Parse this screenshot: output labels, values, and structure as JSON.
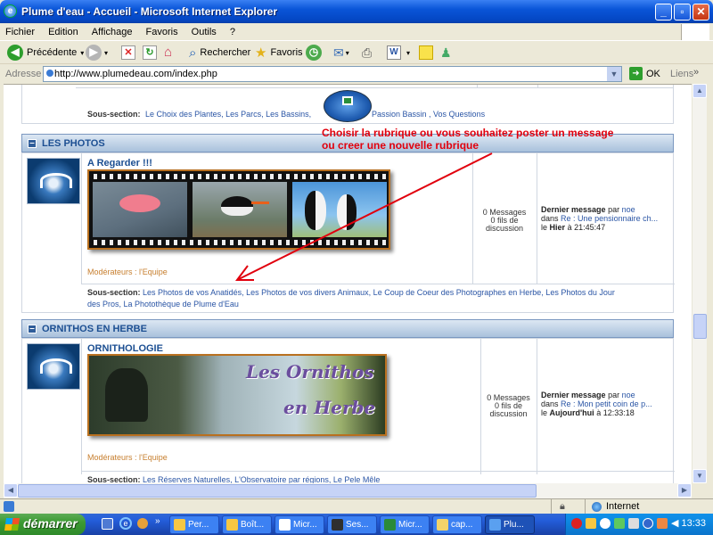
{
  "window": {
    "title": "Plume d'eau - Accueil - Microsoft Internet Explorer"
  },
  "menu": [
    "Fichier",
    "Edition",
    "Affichage",
    "Favoris",
    "Outils",
    "?"
  ],
  "toolbar": {
    "back": "Précédente",
    "search": "Rechercher",
    "favorites": "Favoris"
  },
  "address": {
    "label": "Adresse",
    "url": "http://www.plumedeau.com/index.php",
    "go": "OK",
    "links": "Liens"
  },
  "top_section": {
    "label": "Sous-section:",
    "links": "Le Choix des Plantes, Les Parcs, Les Bassins,",
    "links2": "Passion Bassin , Vos Questions"
  },
  "annotation": {
    "line1": "Choisir la rubrique ou vous souhaitez poster un message",
    "line2": "ou creer une nouvelle rubrique",
    "color": "#e1000d"
  },
  "photos": {
    "header": "LES PHOTOS",
    "forum_title": "A Regarder !!!",
    "moderators": "Modérateurs : l'Equipe",
    "stats": {
      "messages": "0 Messages",
      "threads": "0 fils de",
      "threads2": "discussion"
    },
    "last": {
      "label": "Dernier message",
      "by": "par",
      "user": "noe",
      "in": "dans",
      "topic": "Re : Une pensionnaire ch...",
      "when_prefix": "le",
      "when_day": "Hier",
      "when_time": "à 21:45:47"
    },
    "subs_label": "Sous-section:",
    "subs_line1": "Les Photos de vos Anatidés, Les Photos de vos divers Animaux, Le Coup de Coeur des Photographes en Herbe, Les Photos du Jour",
    "subs_line2": "des Pros, La Photothèque de Plume d'Eau"
  },
  "ornithos": {
    "header": "ORNITHOS EN HERBE",
    "forum_title": "ORNITHOLOGIE",
    "banner_line1": "Les Ornithos",
    "banner_line2": "en Herbe",
    "moderators": "Modérateurs : l'Equipe",
    "stats": {
      "messages": "0 Messages",
      "threads": "0 fils de",
      "threads2": "discussion"
    },
    "last": {
      "label": "Dernier message",
      "by": "par",
      "user": "noe",
      "in": "dans",
      "topic": "Re : Mon petit coin de p...",
      "when_prefix": "le",
      "when_day": "Aujourd'hui",
      "when_time": "à 12:33:18"
    },
    "subs_label": "Sous-section:",
    "subs_line1": "Les Réserves Naturelles, L'Observatoire par régions, Le Pele Mêle"
  },
  "status": {
    "zone": "Internet"
  },
  "taskbar": {
    "start": "démarrer",
    "tasks": [
      "Per...",
      "Boît...",
      "Micr...",
      "Ses...",
      "Micr...",
      "cap...",
      "Plu..."
    ],
    "clock": "13:33"
  },
  "colors": {
    "accent": "#1c4f92",
    "annotation": "#e1000d",
    "moderator": "#c77f2f",
    "taskbar": "#245edb"
  }
}
